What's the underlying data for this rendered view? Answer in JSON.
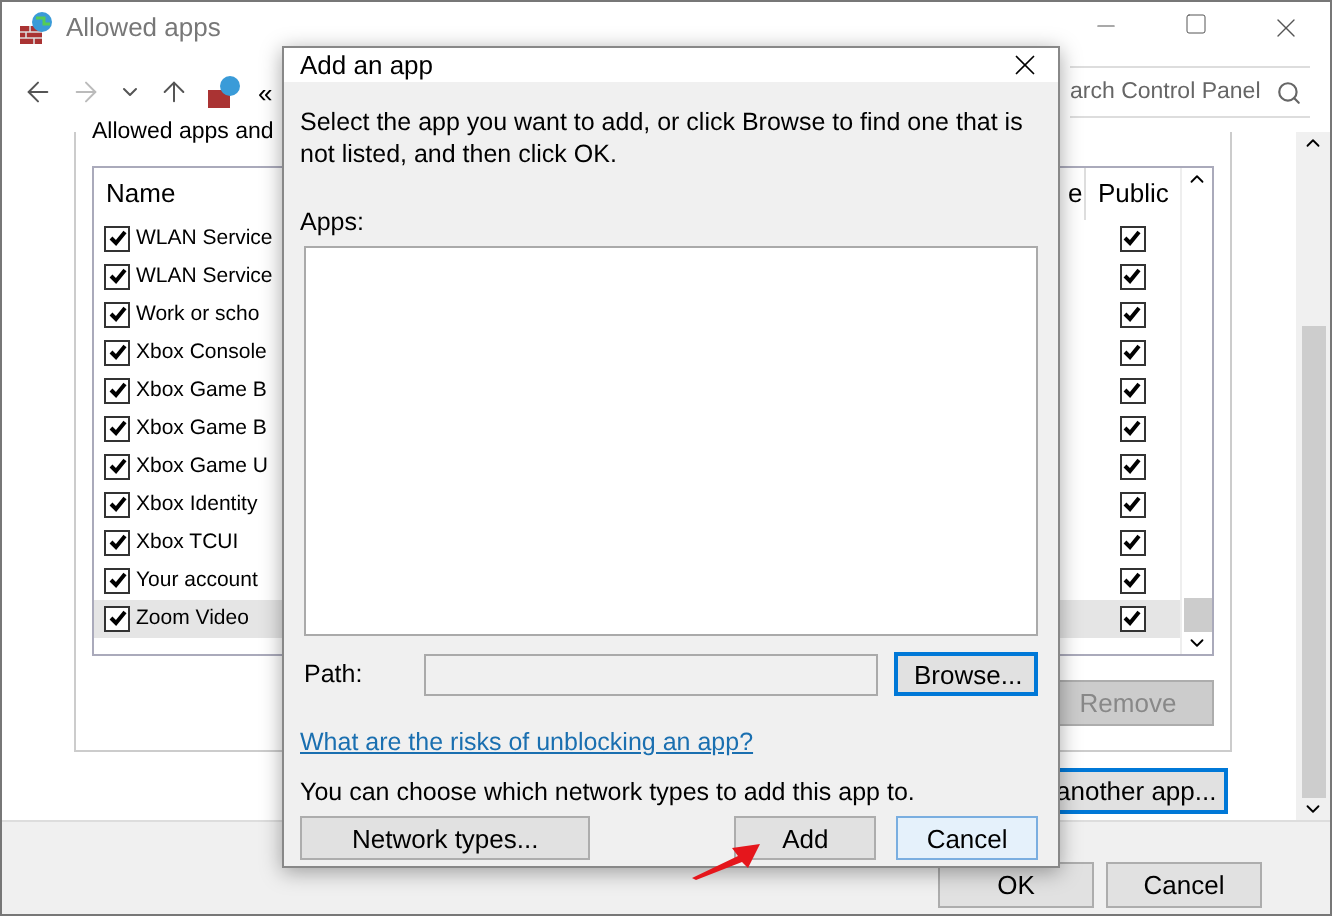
{
  "window": {
    "title": "Allowed apps",
    "breadcrumb": "«",
    "search_placeholder": "arch Control Panel"
  },
  "section_heading": "Allowed apps and",
  "list": {
    "columns": [
      "Name",
      "e",
      "Public"
    ],
    "rows": [
      {
        "name": "WLAN Service",
        "checked": true,
        "public": true,
        "selected": false
      },
      {
        "name": "WLAN Service",
        "checked": true,
        "public": true,
        "selected": false
      },
      {
        "name": "Work or scho",
        "checked": true,
        "public": true,
        "selected": false
      },
      {
        "name": "Xbox Console",
        "checked": true,
        "public": true,
        "selected": false
      },
      {
        "name": "Xbox Game B",
        "checked": true,
        "public": true,
        "selected": false
      },
      {
        "name": "Xbox Game B",
        "checked": true,
        "public": true,
        "selected": false
      },
      {
        "name": "Xbox Game U",
        "checked": true,
        "public": true,
        "selected": false
      },
      {
        "name": "Xbox Identity",
        "checked": true,
        "public": true,
        "selected": false
      },
      {
        "name": "Xbox TCUI",
        "checked": true,
        "public": true,
        "selected": false
      },
      {
        "name": "Your account",
        "checked": true,
        "public": true,
        "selected": false
      },
      {
        "name": "Zoom Video",
        "checked": true,
        "public": true,
        "selected": true
      }
    ]
  },
  "remove_button": {
    "label": "Remove",
    "disabled": true
  },
  "allow_another_button": "another app...",
  "footer_buttons": [
    "OK",
    "Cancel"
  ],
  "dialog": {
    "title": "Add an app",
    "instructions": "Select the app you want to add, or click Browse to find one that is not listed, and then click OK.",
    "apps_label": "Apps:",
    "path_label": "Path:",
    "browse_button": "Browse...",
    "risk_link": "What are the risks of unblocking an app?",
    "network_note": "You can choose which network types to add this app to.",
    "buttons": [
      {
        "label": "Network types...",
        "default": false
      },
      {
        "label": "Add",
        "default": false
      },
      {
        "label": "Cancel",
        "default": true
      }
    ]
  }
}
